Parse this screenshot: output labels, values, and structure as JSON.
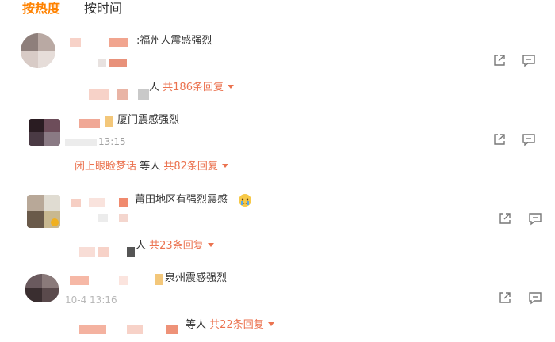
{
  "tabs": [
    {
      "label": "按热度"
    },
    {
      "label": "按时间"
    }
  ],
  "comments": [
    {
      "text": ":福州人震感强烈",
      "reply_names": "人",
      "reply_count": "共186条回复"
    },
    {
      "text": "厦门震感强烈",
      "time": "13:15",
      "reply_names": "闭上眼睑梦话",
      "reply_names_suffix": "等人",
      "reply_count": "共82条回复"
    },
    {
      "text": "莆田地区有强烈震感",
      "reply_names": "人",
      "reply_count": "共23条回复"
    },
    {
      "text": "泉州震感强烈",
      "time": "10-4 13:16",
      "reply_names": "等人",
      "reply_count": "共22条回复"
    }
  ],
  "colors": {
    "accent": "#ff8200",
    "reply": "#eb7350"
  },
  "icons": [
    "share-icon",
    "comment-icon",
    "crying-emoji-icon"
  ]
}
